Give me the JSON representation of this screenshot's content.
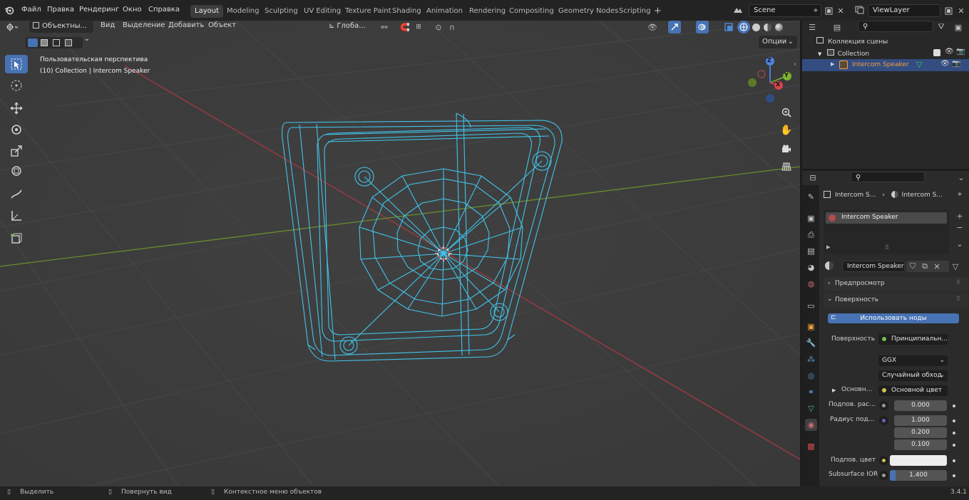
{
  "menu": [
    "Файл",
    "Правка",
    "Рендеринг",
    "Окно",
    "Справка"
  ],
  "workspaces": [
    "Layout",
    "Modeling",
    "Sculpting",
    "UV Editing",
    "Texture Paint",
    "Shading",
    "Animation",
    "Rendering",
    "Compositing",
    "Geometry Nodes",
    "Scripting"
  ],
  "active_workspace": "Layout",
  "add_workspace": "+",
  "scene": "Scene",
  "view_layer": "ViewLayer",
  "viewport_header": {
    "mode": "Объектны...",
    "menus": [
      "Вид",
      "Выделение",
      "Добавить",
      "Объект"
    ],
    "orientation": "Глоба...",
    "options": "Опции"
  },
  "viewport_overlay": {
    "view_name": "Пользовательская перспектива",
    "object_info": "(10) Collection | Intercom Speaker"
  },
  "gizmo": {
    "z": "Z",
    "y": "Y",
    "x": "X"
  },
  "outliner": {
    "scene_collection": "Коллекция сцены",
    "collection": "Collection",
    "object": "Intercom Speaker"
  },
  "properties": {
    "breadcrumb_object": "Intercom S...",
    "breadcrumb_material": "Intercom S...",
    "material_slot": "Intercom Speaker",
    "material_name": "Intercom Speaker",
    "panel_preview": "Предпросмотр",
    "panel_surface": "Поверхность",
    "use_nodes": "Использовать ноды",
    "surface_label": "Поверхность",
    "surface_value": "Принципиальн...",
    "distribution": "GGX",
    "subsurface_method": "Случайный обход",
    "base_label": "Основн...",
    "base_value": "Основной цвет",
    "subsurface_label": "Подпов. рас...",
    "subsurface_value": "0.000",
    "radius_label": "Радиус под...",
    "radius_values": [
      "1.000",
      "0.200",
      "0.100"
    ],
    "subsurface_color_label": "Подпов. цвет",
    "ior_label": "Subsurface IOR",
    "ior_value": "1.400"
  },
  "statusbar": {
    "select": "Выделить",
    "rotate": "Повернуть вид",
    "context": "Контекстное меню объектов",
    "version": "3.4.1"
  },
  "colors": {
    "accent": "#4772b3",
    "wire": "#41c3ea",
    "x_axis": "#c63c45",
    "y_axis": "#6e9a2a",
    "selected_text": "#f0a040"
  }
}
